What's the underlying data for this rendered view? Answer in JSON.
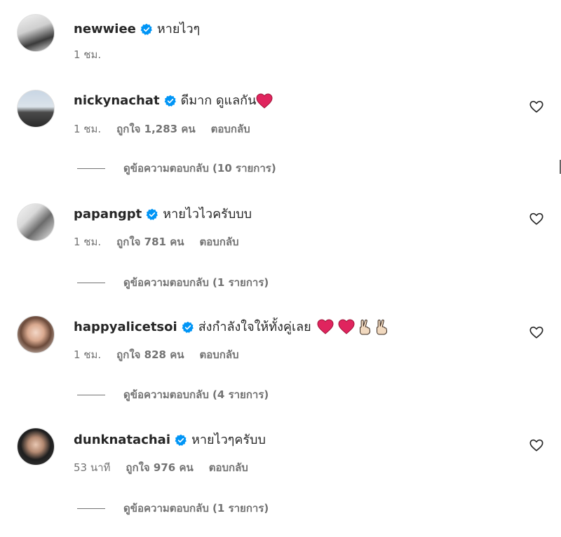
{
  "comments": [
    {
      "username": "newwiee",
      "text": "หายไวๆ",
      "time": "1 ชม.",
      "likes": "",
      "reply_label": "",
      "view_replies": ""
    },
    {
      "username": "nickynachat",
      "text": "ดีมาก ดูแลกัน",
      "time": "1 ชม.",
      "likes": "ถูกใจ 1,283 คน",
      "reply_label": "ตอบกลับ",
      "view_replies": "ดูข้อความตอบกลับ (10 รายการ)"
    },
    {
      "username": "papangpt",
      "text": "หายไวไวครับบบ",
      "time": "1 ชม.",
      "likes": "ถูกใจ 781 คน",
      "reply_label": "ตอบกลับ",
      "view_replies": "ดูข้อความตอบกลับ (1 รายการ)"
    },
    {
      "username": "happyalicetsoi",
      "text": "ส่งกำลังใจให้ทั้งคู่เลย",
      "time": "1 ชม.",
      "likes": "ถูกใจ 828 คน",
      "reply_label": "ตอบกลับ",
      "view_replies": "ดูข้อความตอบกลับ (4 รายการ)"
    },
    {
      "username": "dunknatachai",
      "text": "หายไวๆครับบ",
      "time": "53 นาที",
      "likes": "ถูกใจ 976 คน",
      "reply_label": "ตอบกลับ",
      "view_replies": "ดูข้อความตอบกลับ (1 รายการ)"
    }
  ],
  "colors": {
    "verified_badge": "#0095f6",
    "heart_emoji": "#e0245e",
    "secondary_text": "#737373"
  },
  "icons": [
    "verified-badge-icon",
    "heart-outline-icon",
    "red-heart-emoji",
    "victory-hand-emoji"
  ]
}
